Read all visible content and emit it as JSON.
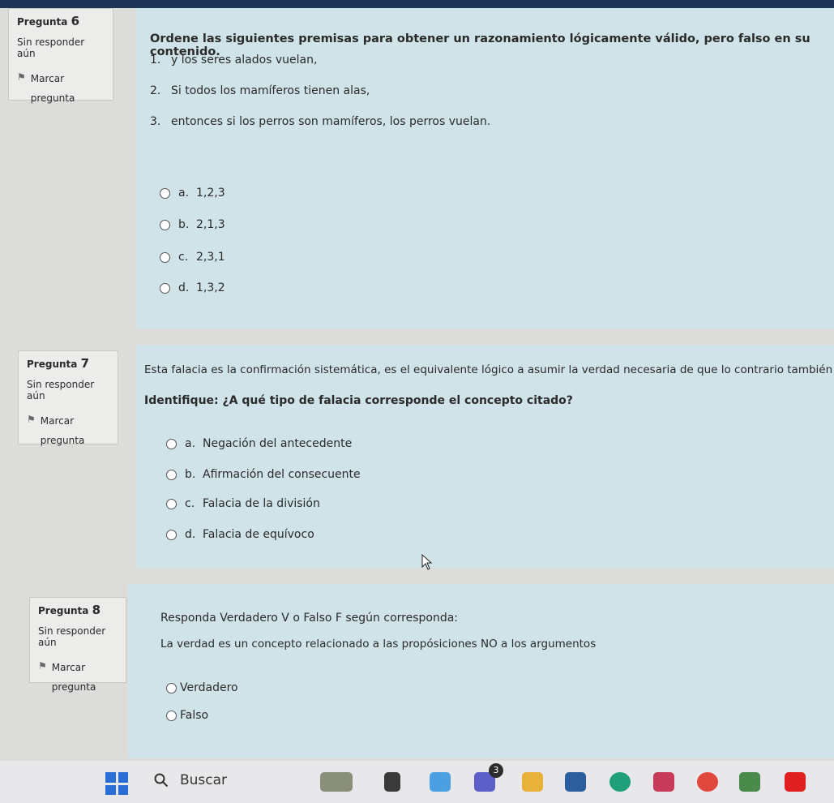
{
  "q6": {
    "number_label": "Pregunta",
    "number": "6",
    "state": "Sin responder aún",
    "flag_label": "Marcar pregunta",
    "prompt": "Ordene las siguientes premisas para obtener un razonamiento lógicamente válido, pero falso en su contenido.",
    "items": [
      {
        "n": "1.",
        "text": "y los seres alados vuelan,"
      },
      {
        "n": "2.",
        "text": "Si todos los mamíferos tienen alas,"
      },
      {
        "n": "3.",
        "text": "entonces si los perros son mamíferos, los perros vuelan."
      }
    ],
    "options": [
      {
        "letter": "a.",
        "text": "1,2,3"
      },
      {
        "letter": "b.",
        "text": "2,1,3"
      },
      {
        "letter": "c.",
        "text": "2,3,1"
      },
      {
        "letter": "d.",
        "text": "1,3,2"
      }
    ]
  },
  "q7": {
    "number_label": "Pregunta",
    "number": "7",
    "state": "Sin responder aún",
    "flag_label": "Marcar pregunta",
    "prompt": "Esta falacia es la confirmación sistemática, es el equivalente lógico a asumir la verdad necesaria de que lo contrario también lo es.",
    "identify": "Identifique: ¿A qué tipo de falacia corresponde el concepto citado?",
    "options": [
      {
        "letter": "a.",
        "text": "Negación del antecedente"
      },
      {
        "letter": "b.",
        "text": "Afirmación del consecuente"
      },
      {
        "letter": "c.",
        "text": "Falacia de la división"
      },
      {
        "letter": "d.",
        "text": "Falacia de equívoco"
      }
    ]
  },
  "q8": {
    "number_label": "Pregunta",
    "number": "8",
    "state": "Sin responder aún",
    "flag_label": "Marcar pregunta",
    "prompt": "Responda Verdadero V o Falso F según corresponda:",
    "statement": "La verdad es un concepto relacionado a las propósiciones NO a los argumentos",
    "options": [
      {
        "text": "Verdadero"
      },
      {
        "text": "Falso"
      }
    ]
  },
  "taskbar": {
    "search_placeholder": "Buscar",
    "badge_count": "3",
    "accent": "#2a6fd6",
    "icons": [
      "windows-start-icon",
      "search-icon",
      "weather-icon",
      "task-view-icon",
      "copilot-icon",
      "teams-icon",
      "file-explorer-icon",
      "store-icon",
      "edge-icon",
      "media-player-icon",
      "music-icon",
      "chat-icon",
      "youtube-icon"
    ]
  }
}
